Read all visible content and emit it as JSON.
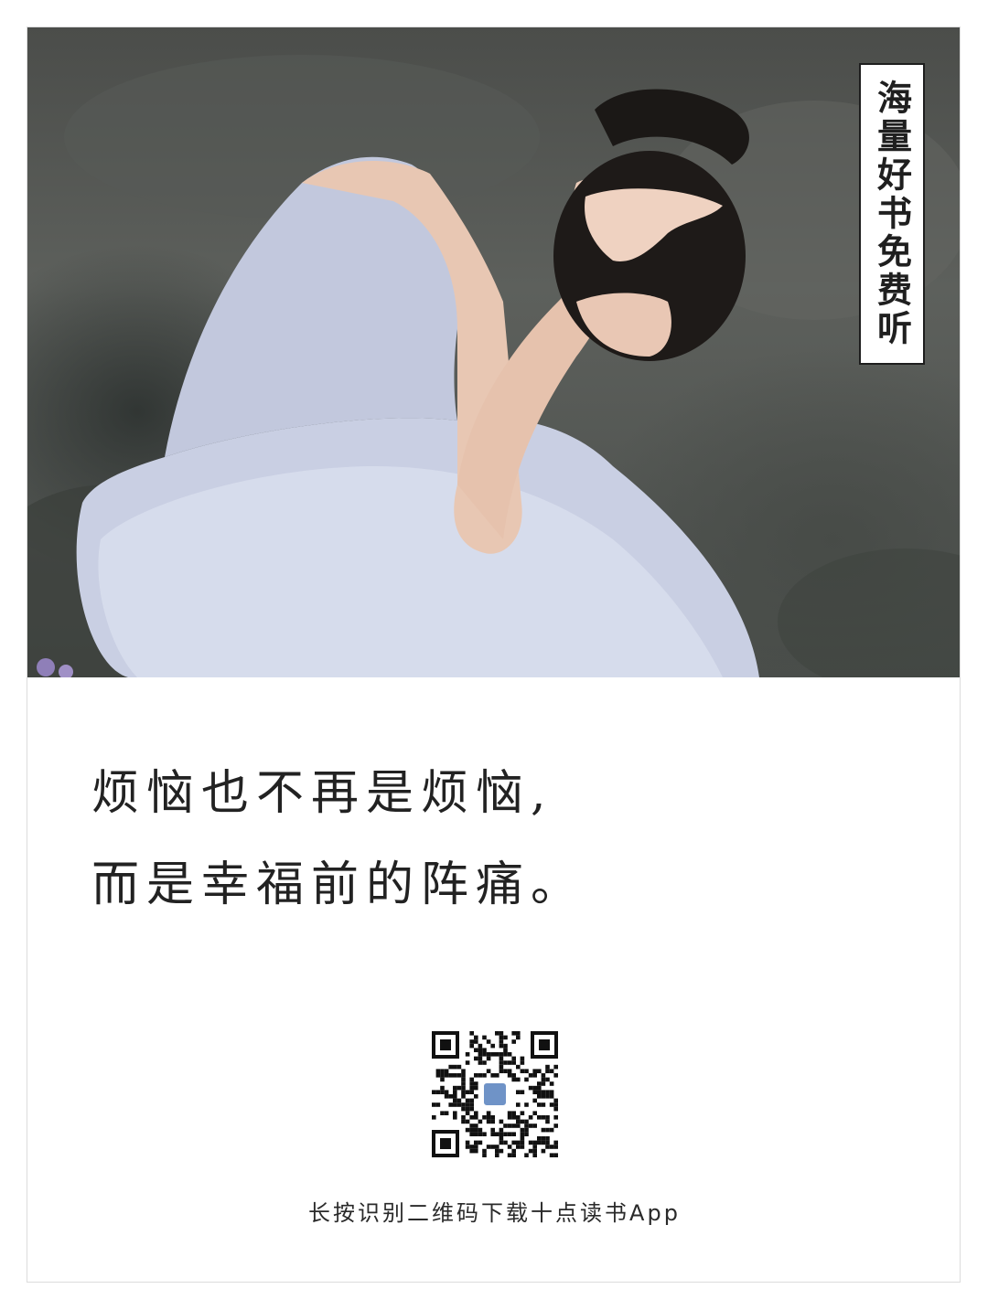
{
  "photo": {
    "side_tag": "海量好书免费听"
  },
  "quote": {
    "line1": "烦恼也不再是烦恼,",
    "line2": "而是幸福前的阵痛。"
  },
  "qr": {
    "logo_icon": "app-logo-icon"
  },
  "footer": {
    "caption": "长按识别二维码下载十点读书App"
  }
}
